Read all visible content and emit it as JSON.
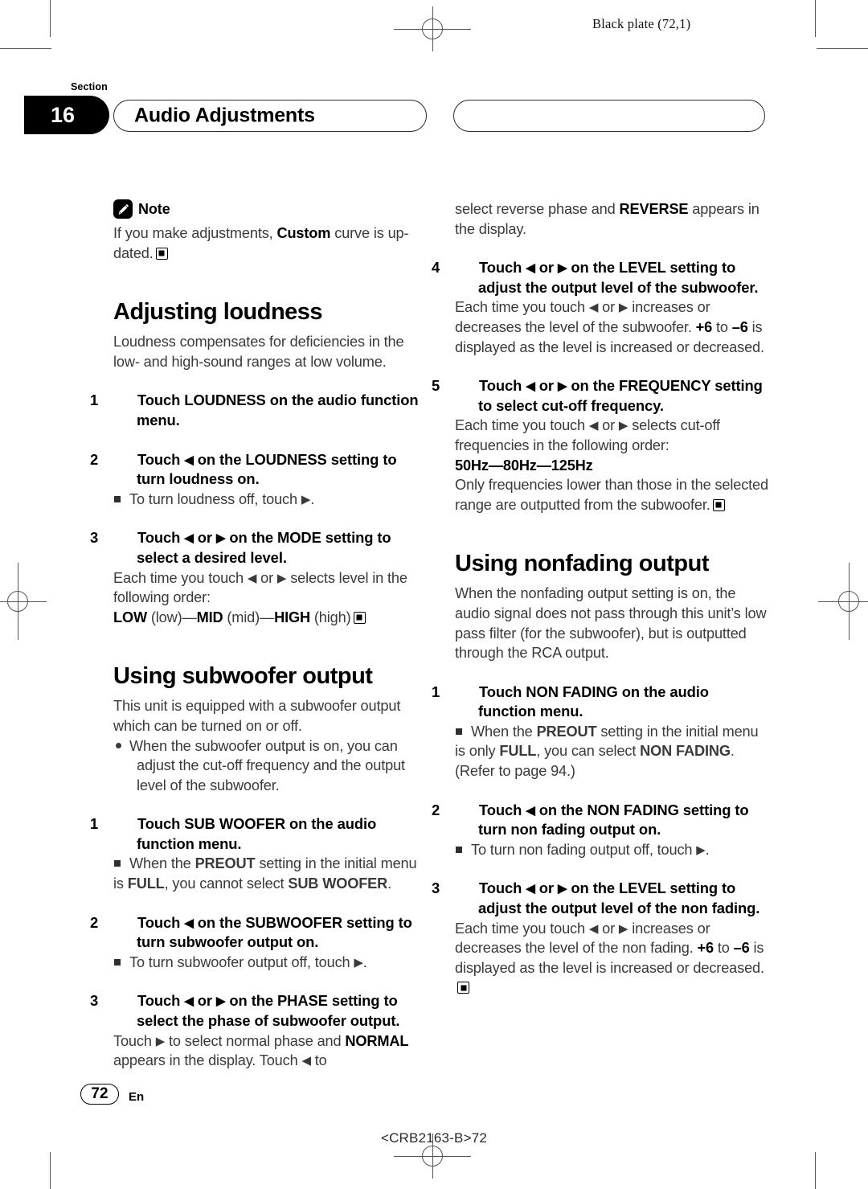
{
  "printmarks": {
    "black_plate": "Black plate (72,1)"
  },
  "header": {
    "section_label": "Section",
    "section_number": "16",
    "title": "Audio Adjustments",
    "right_pill_title": ""
  },
  "left_column": {
    "note": {
      "icon": "pencil-note-icon",
      "label": "Note",
      "text_parts": [
        {
          "t": "If you make adjustments, ",
          "b": false
        },
        {
          "t": "Custom",
          "b": true
        },
        {
          "t": " curve is updated.",
          "b": false
        }
      ],
      "text": "If you make adjustments, Custom curve is updated."
    },
    "heading_loudness": "Adjusting loudness",
    "loudness_intro": "Loudness compensates for deficiencies in the low- and high-sound ranges at low volume.",
    "loudness_steps": [
      {
        "num": "1",
        "text": "Touch LOUDNESS on the audio function menu."
      },
      {
        "num": "2",
        "text": "Touch ◀ on the LOUDNESS setting to turn loudness on.",
        "sub": "To turn loudness off, touch ▶."
      },
      {
        "num": "3",
        "text": "Touch ◀ or ▶ on the MODE setting to select a desired level.",
        "body": "Each time you touch ◀ or ▶ selects level in the following order:",
        "order": "LOW (low)—MID (mid)—HIGH (high)"
      }
    ],
    "heading_subwoofer": "Using subwoofer output",
    "subwoofer_intro": "This unit is equipped with a subwoofer output which can be turned on or off.",
    "subwoofer_bullet": "When the subwoofer output is on, you can adjust the cut-off frequency and the output level of the subwoofer.",
    "subwoofer_steps": [
      {
        "num": "1",
        "text": "Touch SUB WOOFER on the audio function menu.",
        "sub": "When the PREOUT setting in the initial menu is FULL, you cannot select SUB WOOFER."
      },
      {
        "num": "2",
        "text": "Touch ◀ on the SUBWOOFER setting to turn subwoofer output on.",
        "sub": "To turn subwoofer output off, touch ▶."
      },
      {
        "num": "3",
        "text": "Touch ◀ or ▶ on the PHASE setting to select the phase of subwoofer output.",
        "body": "Touch ▶ to select normal phase and NORMAL appears in the display. Touch ◀ to"
      }
    ]
  },
  "right_column": {
    "continuation": "select reverse phase and REVERSE appears in the display.",
    "subwoofer_steps_cont": [
      {
        "num": "4",
        "text": "Touch ◀ or ▶ on the LEVEL setting to adjust the output level of the subwoofer.",
        "body": "Each time you touch ◀ or ▶ increases or decreases the level of the subwoofer. +6 to –6 is displayed as the level is increased or decreased."
      },
      {
        "num": "5",
        "text": "Touch ◀ or ▶ on the FREQUENCY setting to select cut-off frequency.",
        "body": "Each time you touch ◀ or ▶ selects cut-off frequencies in the following order:",
        "order": "50Hz—80Hz—125Hz",
        "after": "Only frequencies lower than those in the selected range are outputted from the subwoofer."
      }
    ],
    "heading_nonfading": "Using nonfading output",
    "nonfading_intro": "When the nonfading output setting is on, the audio signal does not pass through this unit’s low pass filter (for the subwoofer), but is outputted through the RCA output.",
    "nonfading_steps": [
      {
        "num": "1",
        "text": "Touch NON FADING on the audio function menu.",
        "sub": "When the PREOUT setting in the initial menu is only FULL, you can select NON FADING. (Refer to page 94.)"
      },
      {
        "num": "2",
        "text": "Touch ◀ on the NON FADING setting to turn non fading output on.",
        "sub": "To turn non fading output off, touch ▶."
      },
      {
        "num": "3",
        "text": "Touch ◀ or ▶ on the LEVEL setting to adjust the output level of the non fading.",
        "body": "Each time you touch ◀ or ▶ increases or decreases the level of the non fading. +6 to –6 is displayed as the level is increased or decreased."
      }
    ]
  },
  "footer": {
    "page_number": "72",
    "language": "En",
    "doc_code": "<CRB2163-B>72"
  }
}
